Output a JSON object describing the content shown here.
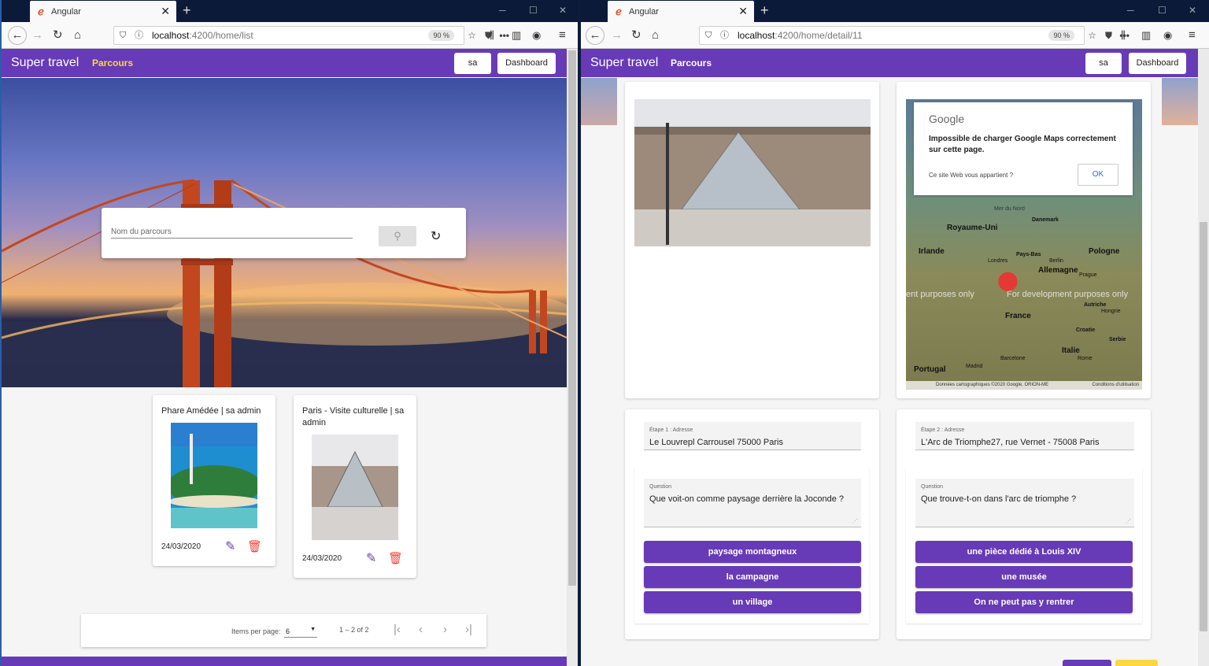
{
  "left": {
    "tab_title": "Angular",
    "url": "localhost:4200/home/list",
    "url_host": "localhost",
    "url_rest": ":4200/home/list",
    "zoom": "90 %",
    "brand": "Super travel",
    "nav_link": "Parcours",
    "user_btn": "sa",
    "dashboard_btn": "Dashboard",
    "search_placeholder": "Nom du parcours",
    "cards": [
      {
        "title": "Phare Amédée | sa admin",
        "date": "24/03/2020"
      },
      {
        "title": "Paris - Visite culturelle | sa admin",
        "date": "24/03/2020"
      }
    ],
    "pager": {
      "items_label": "Items per page:",
      "items_value": "6",
      "range": "1 – 2 of 2"
    }
  },
  "right": {
    "tab_title": "Angular",
    "url": "localhost:4200/home/detail/11",
    "url_host": "localhost",
    "url_rest": ":4200/home/detail/11",
    "zoom": "90 %",
    "brand": "Super travel",
    "nav_link": "Parcours",
    "user_btn": "sa",
    "dashboard_btn": "Dashboard",
    "map": {
      "dialog_logo": "Google",
      "dialog_msg": "Impossible de charger Google Maps correctement sur cette page.",
      "dialog_link": "Ce site Web vous appartient ?",
      "dialog_ok": "OK",
      "watermark": "For development purposes only",
      "watermark_left": "ent purposes only",
      "attribution": "Données cartographiques ©2020 Google, ORION-ME",
      "terms": "Conditions d'utilisation",
      "labels": [
        "Royaume-Uni",
        "Irlande",
        "Pologne",
        "Allemagne",
        "France",
        "Italie",
        "Portugal",
        "Madrid",
        "Danemark",
        "Croatie",
        "Serbie",
        "Autriche",
        "Prague",
        "Londres",
        "Berlin",
        "Pays-Bas",
        "Barcelone",
        "Rome",
        "Hongrie",
        "Mer du Nord"
      ]
    },
    "steps": [
      {
        "address_label": "Étape 1 : Adresse",
        "address": "Le Louvrepl Carrousel 75000 Paris",
        "question_label": "Question",
        "question": "Que voit-on comme paysage derrière la Joconde ?",
        "answers": [
          "paysage montagneux",
          "la campagne",
          "un village"
        ]
      },
      {
        "address_label": "Étape 2 : Adresse",
        "address": "L'Arc de Triomphe27, rue Vernet - 75008 Paris",
        "question_label": "Question",
        "question": "Que trouve-t-on dans l'arc de triomphe ?",
        "answers": [
          "une pièce dédié à Louis XIV",
          "une musée",
          "On ne peut pas y rentrer"
        ]
      }
    ]
  },
  "colors": {
    "primary": "#673ab7",
    "accent": "#ffd740",
    "warn": "#f44336"
  }
}
